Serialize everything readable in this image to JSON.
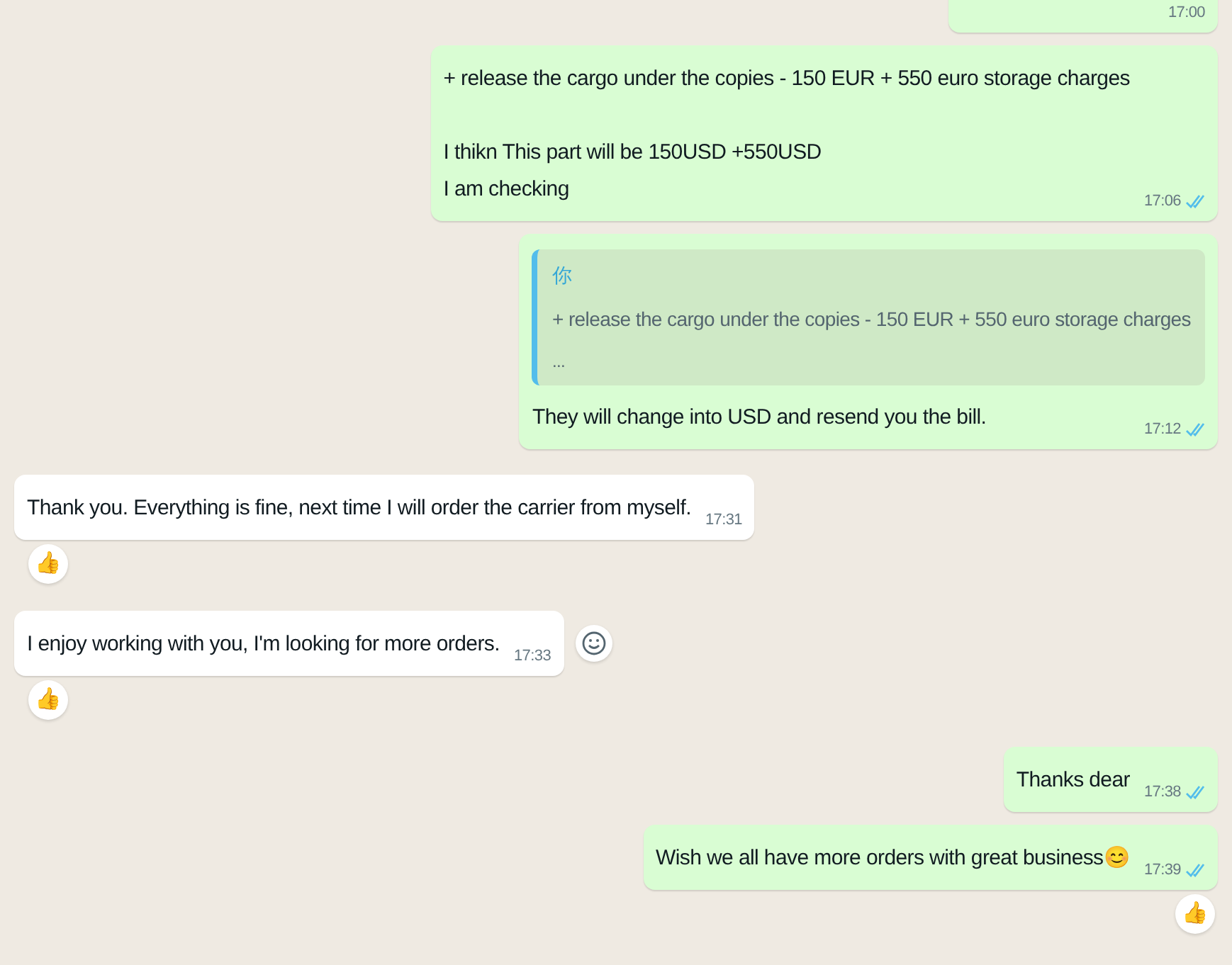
{
  "messages": [
    {
      "kind": "out",
      "time": "17:00"
    },
    {
      "kind": "out",
      "paragraphs": [
        [
          "+ release the cargo under the copies - 150 EUR + 550 euro storage charges"
        ],
        [
          "I thikn This part will be 150USD +550USD",
          "I am checking"
        ]
      ],
      "time": "17:06",
      "read": true
    },
    {
      "kind": "out",
      "quote": {
        "author": "你",
        "text": "+ release the cargo under the copies - 150 EUR + 550 euro storage charges",
        "more": "..."
      },
      "lines": [
        "They will change into USD and resend you the bill."
      ],
      "time": "17:12",
      "read": true
    },
    {
      "kind": "in",
      "lines": [
        "Thank you. Everything is fine, next time I will order the carrier from myself."
      ],
      "time": "17:31",
      "reaction": "👍"
    },
    {
      "kind": "in",
      "lines": [
        "I enjoy working with you, I'm looking for more orders."
      ],
      "time": "17:33",
      "reaction": "👍",
      "react_button": true
    },
    {
      "kind": "out",
      "lines": [
        "Thanks dear"
      ],
      "time": "17:38",
      "read": true
    },
    {
      "kind": "out",
      "lines": [
        "Wish we all have more orders with great business😊"
      ],
      "time": "17:39",
      "read": true,
      "reaction": "👍"
    }
  ]
}
